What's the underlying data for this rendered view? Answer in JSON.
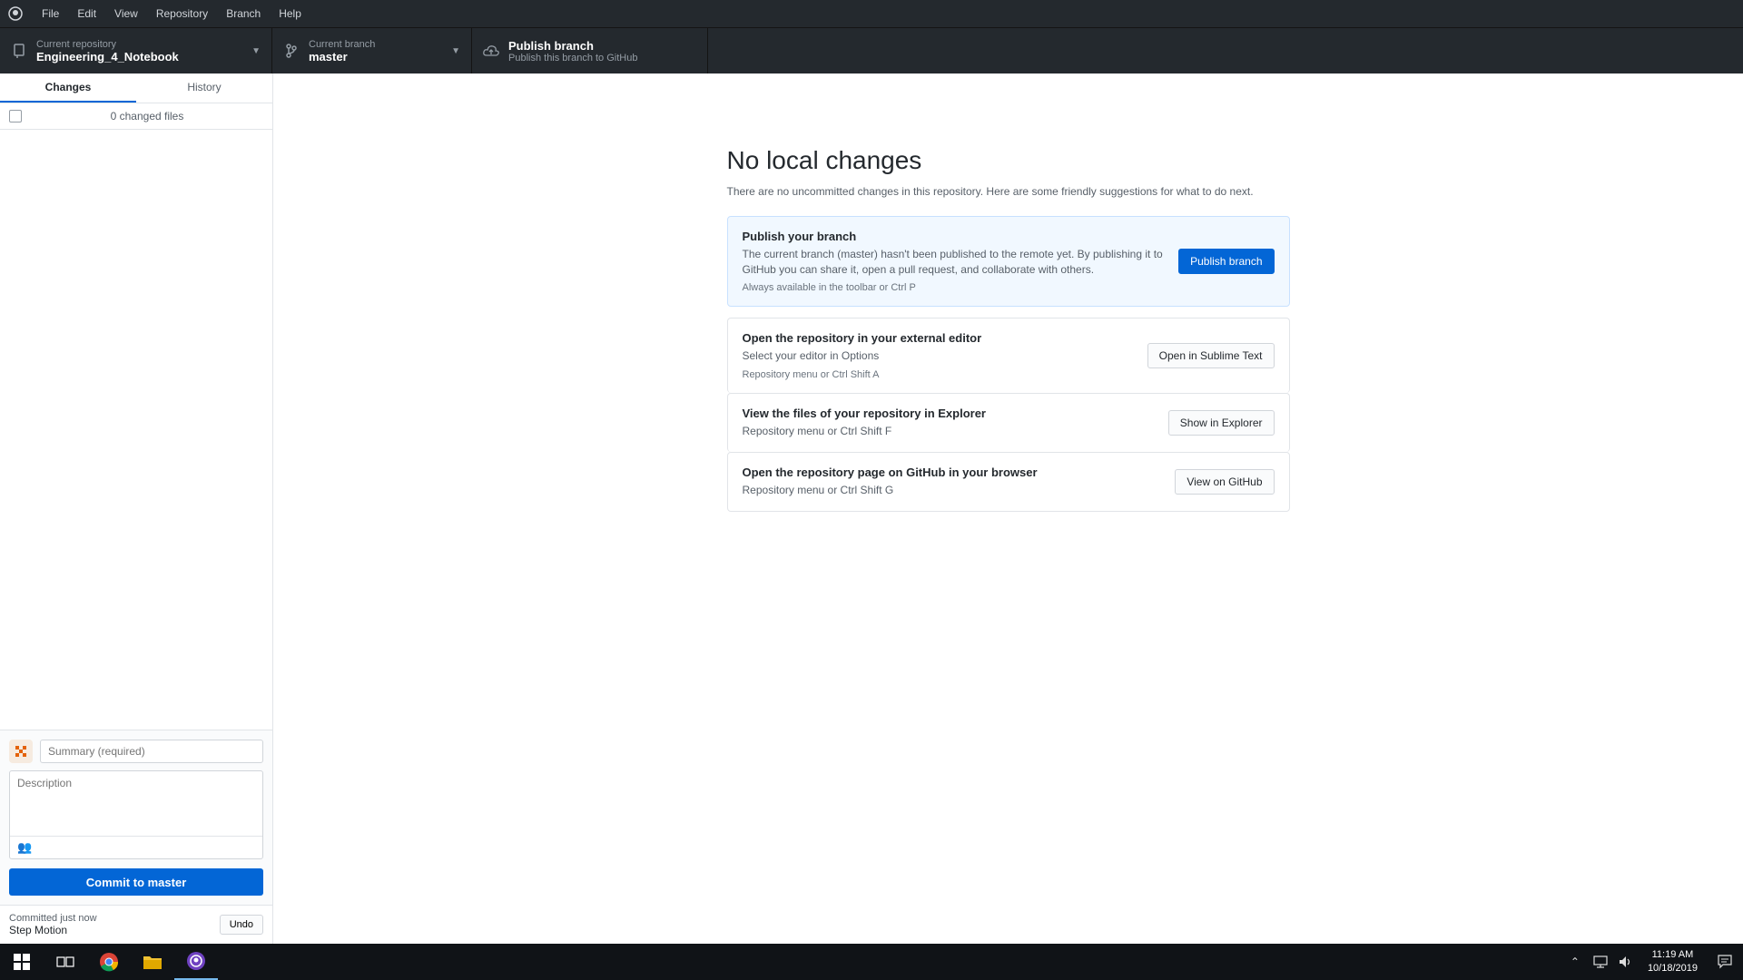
{
  "menu": [
    "File",
    "Edit",
    "View",
    "Repository",
    "Branch",
    "Help"
  ],
  "toolbar": {
    "repo_label": "Current repository",
    "repo_value": "Engineering_4_Notebook",
    "branch_label": "Current branch",
    "branch_value": "master",
    "publish_title": "Publish branch",
    "publish_desc": "Publish this branch to GitHub"
  },
  "sidebar": {
    "tabs": [
      "Changes",
      "History"
    ],
    "changed_files": "0 changed files"
  },
  "commit": {
    "summary_placeholder": "Summary (required)",
    "description_placeholder": "Description",
    "coauthor_glyph": "👥",
    "button_label": "Commit to master"
  },
  "undo": {
    "title": "Committed just now",
    "message": "Step Motion",
    "button_label": "Undo"
  },
  "main": {
    "title": "No local changes",
    "subtitle": "There are no uncommitted changes in this repository. Here are some friendly suggestions for what to do next.",
    "cards": [
      {
        "title": "Publish your branch",
        "desc": "The current branch (master) hasn't been published to the remote yet. By publishing it to GitHub you can share it, open a pull request, and collaborate with others.",
        "hint": "Always available in the toolbar or Ctrl P",
        "button": "Publish branch"
      },
      {
        "title": "Open the repository in your external editor",
        "desc": "Select your editor in Options",
        "hint": "Repository menu or Ctrl Shift A",
        "button": "Open in Sublime Text"
      },
      {
        "title": "View the files of your repository in Explorer",
        "desc": "Repository menu or Ctrl Shift F",
        "hint": "",
        "button": "Show in Explorer"
      },
      {
        "title": "Open the repository page on GitHub in your browser",
        "desc": "Repository menu or Ctrl Shift G",
        "hint": "",
        "button": "View on GitHub"
      }
    ]
  },
  "taskbar": {
    "time": "11:19 AM",
    "date": "10/18/2019"
  },
  "colors": {
    "accent": "#0366d6",
    "toolbar_bg": "#24292e",
    "taskbar_bg": "#101317"
  }
}
